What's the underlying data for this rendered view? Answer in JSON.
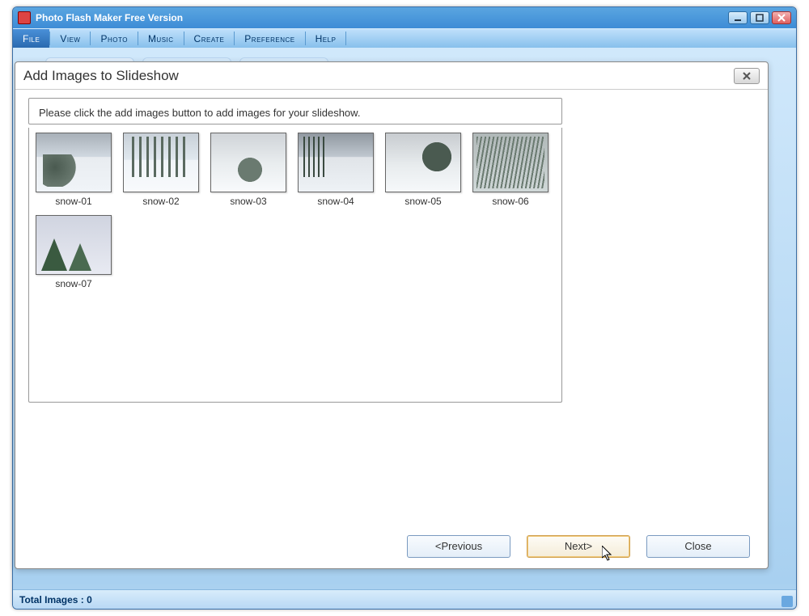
{
  "window": {
    "title": "Photo Flash Maker Free Version"
  },
  "menu": {
    "items": [
      "File",
      "View",
      "Photo",
      "Music",
      "Create",
      "Preference",
      "Help"
    ],
    "active_index": 0
  },
  "status": {
    "text": "Total Images : 0"
  },
  "dialog": {
    "title": "Add Images to Slideshow",
    "instruction": "Please click the add images button to add  images for your slideshow.",
    "thumbs": [
      {
        "label": "snow-01"
      },
      {
        "label": "snow-02"
      },
      {
        "label": "snow-03"
      },
      {
        "label": "snow-04"
      },
      {
        "label": "snow-05"
      },
      {
        "label": "snow-06"
      },
      {
        "label": "snow-07"
      }
    ],
    "buttons": {
      "previous": "<Previous",
      "next": "Next>",
      "close": "Close"
    }
  }
}
